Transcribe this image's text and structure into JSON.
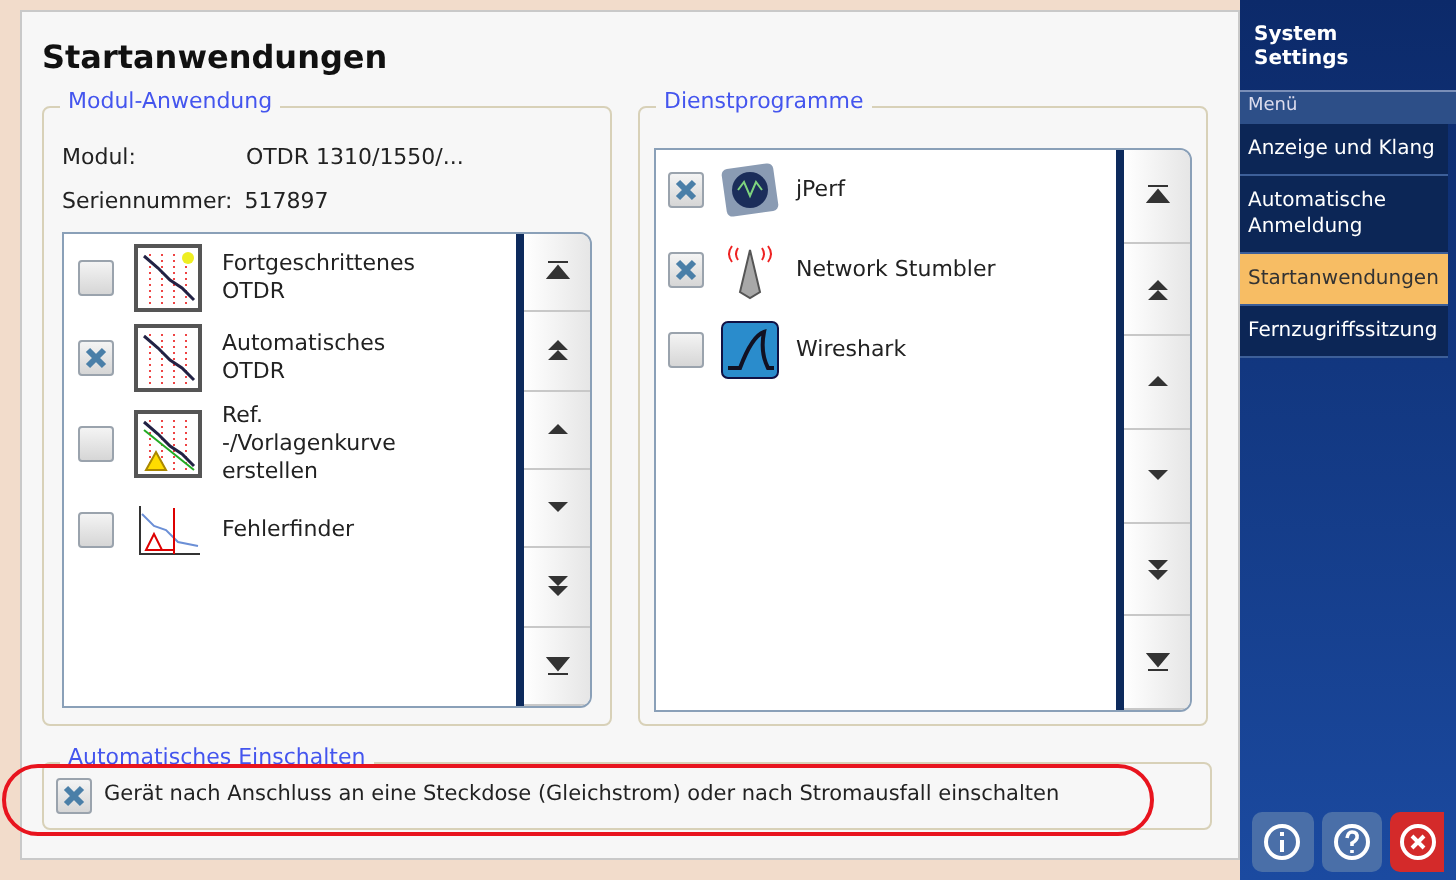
{
  "title": "Startanwendungen",
  "module_group": {
    "legend": "Modul-Anwendung",
    "module_label": "Modul:",
    "module_value": "OTDR 1310/1550/...",
    "serial_label": "Seriennummer:",
    "serial_value": "517897",
    "items": [
      {
        "label": "Fortgeschrittenes OTDR",
        "checked": false
      },
      {
        "label": "Automatisches OTDR",
        "checked": true
      },
      {
        "label": "Ref. -/Vorlagenkurve erstellen",
        "checked": false
      },
      {
        "label": "Fehlerfinder",
        "checked": false
      }
    ]
  },
  "utilities_group": {
    "legend": "Dienstprogramme",
    "items": [
      {
        "label": "jPerf",
        "checked": true
      },
      {
        "label": "Network Stumbler",
        "checked": true
      },
      {
        "label": "Wireshark",
        "checked": false
      }
    ]
  },
  "auto_power": {
    "legend": "Automatisches Einschalten",
    "label": "Gerät nach Anschluss an eine Steckdose (Gleichstrom) oder nach Stromausfall einschalten",
    "checked": true,
    "highlighted": true
  },
  "sidebar": {
    "title": "System Settings",
    "section": "Menü",
    "items": [
      {
        "label": "Anzeige und Klang",
        "selected": false
      },
      {
        "label": "Automatische Anmeldung",
        "selected": false
      },
      {
        "label": "Startanwendungen",
        "selected": true
      },
      {
        "label": "Fernzugriffssitzung",
        "selected": false
      }
    ]
  }
}
